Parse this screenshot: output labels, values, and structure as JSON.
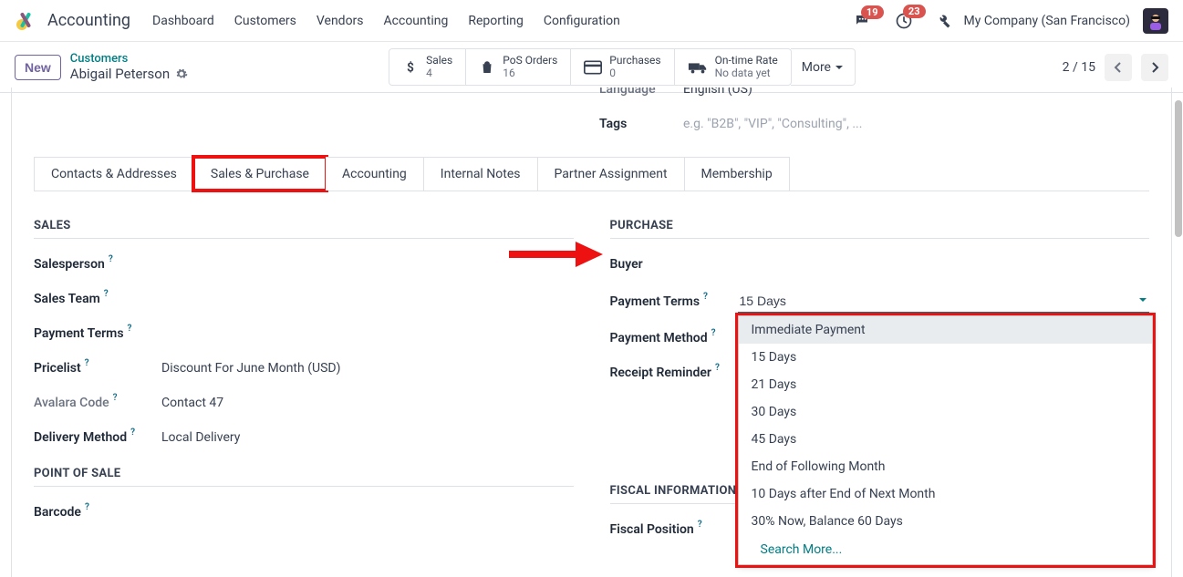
{
  "app_name": "Accounting",
  "nav": [
    "Dashboard",
    "Customers",
    "Vendors",
    "Accounting",
    "Reporting",
    "Configuration"
  ],
  "topbar": {
    "messages_badge": "19",
    "activities_badge": "23",
    "company": "My Company (San Francisco)"
  },
  "control": {
    "new_label": "New",
    "breadcrumb_top": "Customers",
    "breadcrumb_name": "Abigail Peterson",
    "stats": [
      {
        "label": "Sales",
        "value": "4"
      },
      {
        "label": "PoS Orders",
        "value": "16"
      },
      {
        "label": "Purchases",
        "value": "0"
      },
      {
        "label": "On-time Rate",
        "value": "No data yet"
      }
    ],
    "more_label": "More",
    "pager": "2 / 15"
  },
  "upper": {
    "language_label": "Language",
    "language_value": "English (US)",
    "tags_label": "Tags",
    "tags_placeholder": "e.g. \"B2B\", \"VIP\", \"Consulting\", ..."
  },
  "tabs": [
    "Contacts & Addresses",
    "Sales & Purchase",
    "Accounting",
    "Internal Notes",
    "Partner Assignment",
    "Membership"
  ],
  "active_tab_index": 1,
  "sales": {
    "title": "SALES",
    "rows": {
      "salesperson": "Salesperson",
      "sales_team": "Sales Team",
      "payment_terms": "Payment Terms",
      "pricelist": "Pricelist",
      "pricelist_value": "Discount For June Month (USD)",
      "avalara_code": "Avalara Code",
      "avalara_value": "Contact 47",
      "delivery_method": "Delivery Method",
      "delivery_value": "Local Delivery"
    }
  },
  "pos": {
    "title": "POINT OF SALE",
    "barcode": "Barcode"
  },
  "purchase": {
    "title": "PURCHASE",
    "buyer": "Buyer",
    "payment_terms": "Payment Terms",
    "payment_terms_value": "15 Days",
    "payment_method": "Payment Method",
    "receipt_reminder": "Receipt Reminder"
  },
  "fiscal": {
    "title": "FISCAL INFORMATION",
    "fiscal_position": "Fiscal Position"
  },
  "dropdown_options": [
    "Immediate Payment",
    "15 Days",
    "21 Days",
    "30 Days",
    "45 Days",
    "End of Following Month",
    "10 Days after End of Next Month",
    "30% Now, Balance 60 Days"
  ],
  "dropdown_search_more": "Search More..."
}
